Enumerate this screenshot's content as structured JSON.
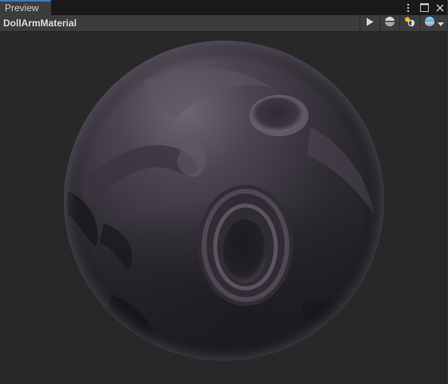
{
  "window": {
    "tab_label": "Preview"
  },
  "toolbar": {
    "material_name": "DollArmMaterial"
  },
  "icons": {
    "tab_menu": "vertical-ellipsis-icon",
    "maximize": "maximize-icon",
    "close": "close-icon",
    "play": "play-icon",
    "preview_mesh": "sphere-mesh-icon",
    "lighting": "light-toggle-icon",
    "background": "background-sphere-icon",
    "dropdown": "chevron-down-icon"
  },
  "colors": {
    "panel_bg": "#282828",
    "toolbar_bg": "#3c3c3c",
    "tab_accent": "#3a79bb",
    "light_icon": "#f0c21c",
    "sphere_base": "#2b2830"
  }
}
